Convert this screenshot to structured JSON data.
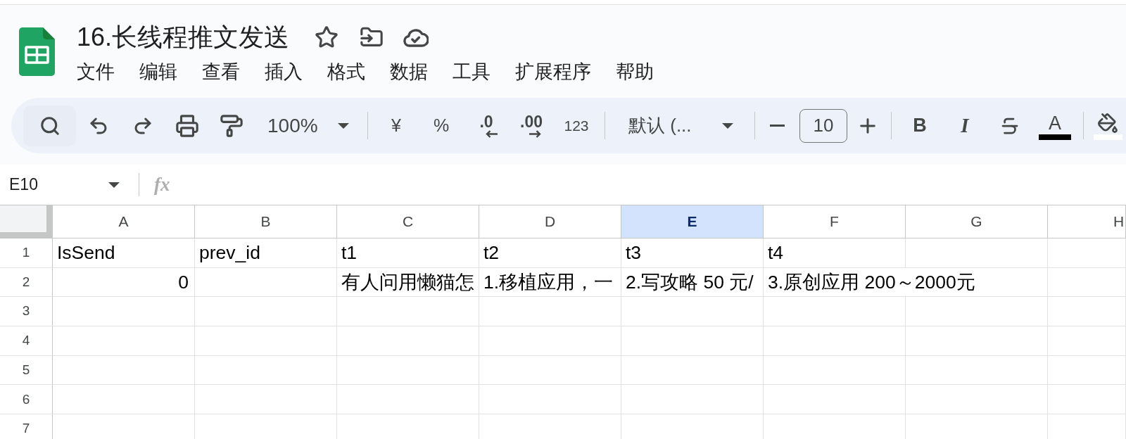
{
  "document": {
    "title": "16.长线程推文发送"
  },
  "menu": [
    "文件",
    "编辑",
    "查看",
    "插入",
    "格式",
    "数据",
    "工具",
    "扩展程序",
    "帮助"
  ],
  "toolbar": [
    [
      {
        "kind": "search"
      },
      {
        "kind": "undo"
      },
      {
        "kind": "redo"
      },
      {
        "kind": "print"
      },
      {
        "kind": "paint-format"
      },
      {
        "kind": "zoom-dropdown",
        "text": "100%"
      }
    ],
    [
      {
        "kind": "currency",
        "text": "¥"
      },
      {
        "kind": "percent",
        "text": "%"
      },
      {
        "kind": "decimal-decrease",
        "text": ".0"
      },
      {
        "kind": "decimal-increase",
        "text": ".00"
      },
      {
        "kind": "number-format",
        "text": "123"
      }
    ],
    [
      {
        "kind": "font-dropdown",
        "text": "默认 (..."
      }
    ],
    [
      {
        "kind": "minus"
      },
      {
        "kind": "size-field",
        "text": "10"
      },
      {
        "kind": "plus"
      }
    ],
    [
      {
        "kind": "bold",
        "text": "B"
      },
      {
        "kind": "italic",
        "text": "I"
      },
      {
        "kind": "strikethrough"
      },
      {
        "kind": "text-color",
        "text": "A",
        "color": "#000000"
      }
    ],
    [
      {
        "kind": "fill-color",
        "color": "#ffffff"
      }
    ]
  ],
  "name_box": {
    "value": "E10"
  },
  "formula_bar": {
    "label": "fx"
  },
  "grid": {
    "columns": [
      {
        "label": "A",
        "selected": false
      },
      {
        "label": "B",
        "selected": false
      },
      {
        "label": "C",
        "selected": false
      },
      {
        "label": "D",
        "selected": false
      },
      {
        "label": "E",
        "selected": true
      },
      {
        "label": "F",
        "selected": false
      },
      {
        "label": "G",
        "selected": false
      },
      {
        "label": "H",
        "selected": false
      }
    ],
    "rows": [
      {
        "number": "1",
        "cells": [
          {
            "kind": "text",
            "text": "IsSend"
          },
          {
            "kind": "text",
            "text": "prev_id"
          },
          {
            "kind": "text",
            "text": "t1"
          },
          {
            "kind": "text",
            "text": "t2"
          },
          {
            "kind": "text",
            "text": "t3"
          },
          {
            "kind": "text",
            "text": "t4"
          }
        ]
      },
      {
        "number": "2",
        "cells": [
          {
            "kind": "number",
            "text": "0"
          },
          null,
          {
            "kind": "text",
            "text": "有人问用懒猫怎"
          },
          {
            "kind": "text",
            "text": "1.移植应用，一"
          },
          {
            "kind": "text",
            "text": "2.写攻略 50 元/"
          },
          {
            "kind": "text",
            "text": "3.原创应用 200～2000元"
          }
        ]
      },
      {
        "number": "3"
      },
      {
        "number": "4"
      },
      {
        "number": "5"
      },
      {
        "number": "6"
      },
      {
        "number": "7"
      }
    ]
  }
}
